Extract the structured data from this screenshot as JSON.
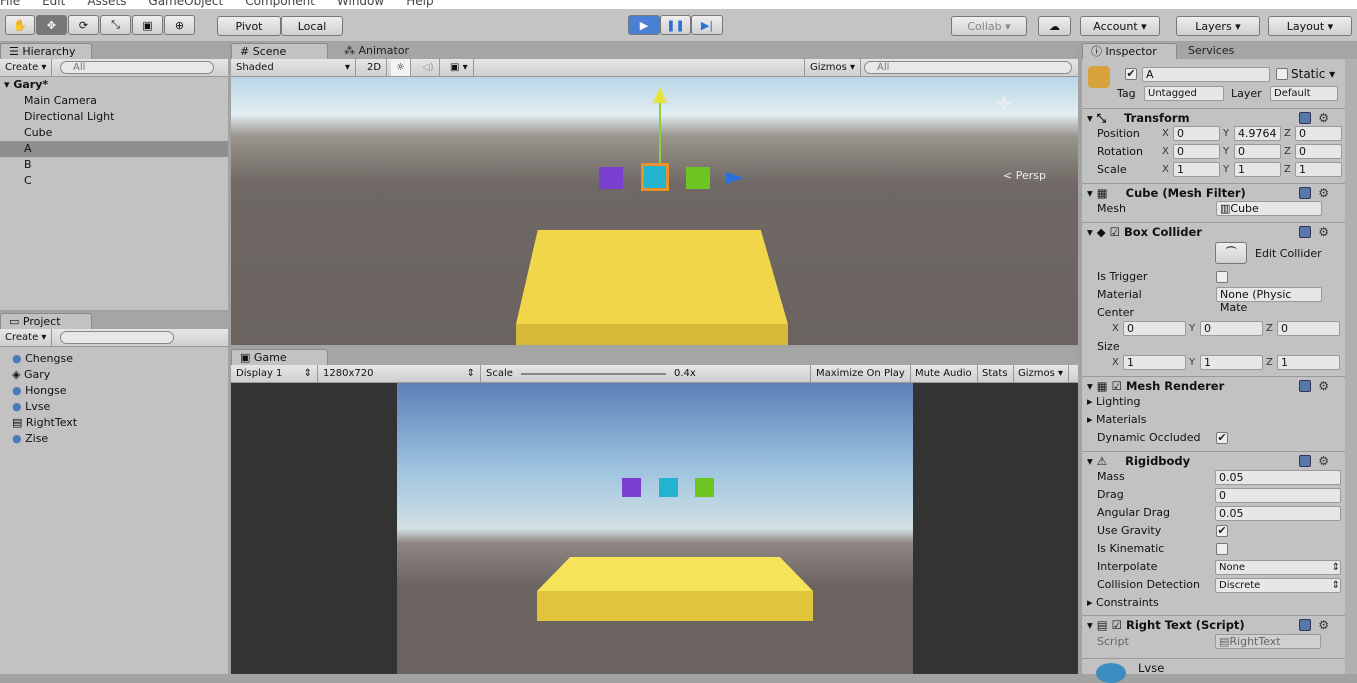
{
  "menu": [
    "File",
    "Edit",
    "Assets",
    "GameObject",
    "Component",
    "Window",
    "Help"
  ],
  "toolbar": {
    "tools": [
      "hand-icon",
      "move-icon",
      "rotate-icon",
      "scale-icon",
      "rect-icon",
      "transform-icon"
    ],
    "pivot": "Pivot",
    "local": "Local",
    "collab": "Collab",
    "account": "Account",
    "layers": "Layers",
    "layout": "Layout"
  },
  "hierarchy": {
    "tab": "Hierarchy",
    "create": "Create",
    "search": "All",
    "scene": "Gary*",
    "items": [
      "Main Camera",
      "Directional Light",
      "Cube",
      "A",
      "B",
      "C"
    ],
    "selected": 3
  },
  "project": {
    "tab": "Project",
    "create": "Create",
    "items": [
      "Chengse",
      "Gary",
      "Hongse",
      "Lvse",
      "RightText",
      "Zise"
    ]
  },
  "scene": {
    "tabs": [
      "Scene",
      "Animator"
    ],
    "shading": "Shaded",
    "mode2d": "2D",
    "gizmos": "Gizmos",
    "search": "All",
    "persp": "Persp"
  },
  "game": {
    "tab": "Game",
    "display": "Display 1",
    "resolution": "1280x720",
    "scale_label": "Scale",
    "scale_value": "0.4x",
    "maximize": "Maximize On Play",
    "mute": "Mute Audio",
    "stats": "Stats",
    "gizmos": "Gizmos"
  },
  "inspector": {
    "tabs": [
      "Inspector",
      "Services"
    ],
    "name": "A",
    "static": "Static",
    "tag_label": "Tag",
    "tag": "Untagged",
    "layer_label": "Layer",
    "layer": "Default",
    "transform": {
      "title": "Transform",
      "rows": [
        {
          "label": "Position",
          "x": "0",
          "y": "4.9764",
          "z": "0"
        },
        {
          "label": "Rotation",
          "x": "0",
          "y": "0",
          "z": "0"
        },
        {
          "label": "Scale",
          "x": "1",
          "y": "1",
          "z": "1"
        }
      ]
    },
    "mesh_filter": {
      "title": "Cube (Mesh Filter)",
      "mesh_label": "Mesh",
      "mesh": "Cube"
    },
    "box_collider": {
      "title": "Box Collider",
      "edit": "Edit Collider",
      "is_trigger": "Is Trigger",
      "material_label": "Material",
      "material": "None (Physic Mate",
      "center": "Center",
      "cx": "0",
      "cy": "0",
      "cz": "0",
      "size": "Size",
      "sx": "1",
      "sy": "1",
      "sz": "1"
    },
    "mesh_renderer": {
      "title": "Mesh Renderer",
      "lighting": "Lighting",
      "materials": "Materials",
      "dyn": "Dynamic Occluded"
    },
    "rigidbody": {
      "title": "Rigidbody",
      "mass_label": "Mass",
      "mass": "0.05",
      "drag_label": "Drag",
      "drag": "0",
      "adrag_label": "Angular Drag",
      "adrag": "0.05",
      "gravity": "Use Gravity",
      "kinematic": "Is Kinematic",
      "interp_label": "Interpolate",
      "interp": "None",
      "coll_label": "Collision Detection",
      "coll": "Discrete",
      "constraints": "Constraints"
    },
    "script": {
      "title": "Right Text (Script)",
      "label": "Script",
      "value": "RightText"
    },
    "material": {
      "title": "Lvse"
    }
  },
  "colors": {
    "purple": "#7b3fd0",
    "cyan": "#22b4cf",
    "green": "#6cc520",
    "yellow": "#f2d64a",
    "play_active": "#4a7fd6"
  }
}
